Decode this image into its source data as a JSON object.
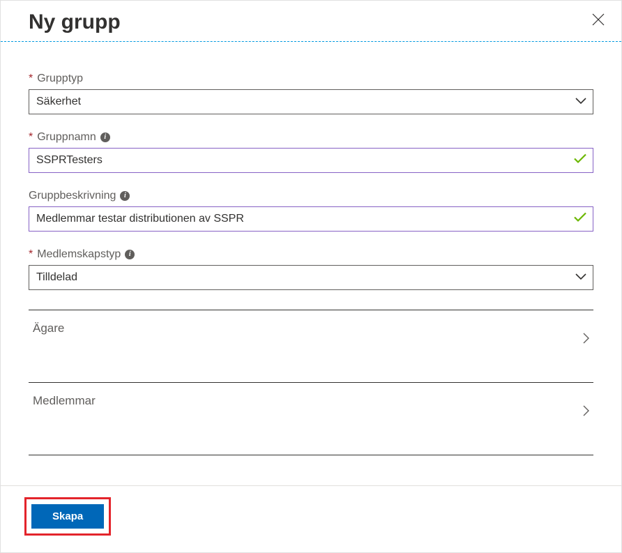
{
  "header": {
    "title": "Ny grupp"
  },
  "fields": {
    "groupType": {
      "label": "Grupptyp",
      "value": "Säkerhet"
    },
    "groupName": {
      "label": "Gruppnamn",
      "value": "SSPRTesters"
    },
    "groupDescription": {
      "label": "Gruppbeskrivning",
      "value": "Medlemmar testar distributionen av SSPR"
    },
    "membershipType": {
      "label": "Medlemskapstyp",
      "value": "Tilldelad"
    }
  },
  "links": {
    "owners": "Ägare",
    "members": "Medlemmar"
  },
  "buttons": {
    "create": "Skapa"
  }
}
